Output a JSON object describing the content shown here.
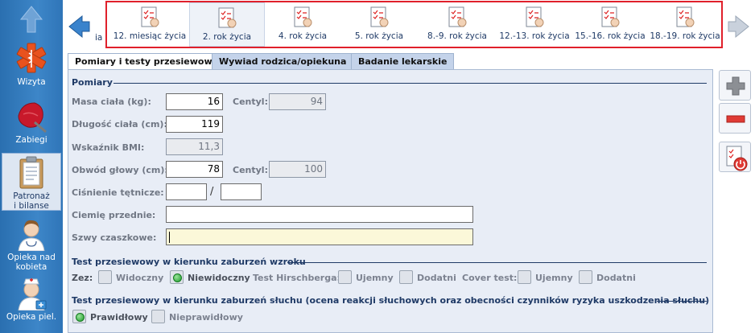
{
  "sidebar": {
    "items": [
      {
        "label": "Wizyta",
        "icon": "star-of-life-icon"
      },
      {
        "label": "Zabiegi",
        "icon": "leaf-icon"
      },
      {
        "label": "Patronaż\ni bilanse",
        "icon": "clipboard-icon"
      },
      {
        "label": "Opieka nad\nkobieta",
        "icon": "doctor-icon"
      },
      {
        "label": "Opieka piel.",
        "icon": "nurse-icon"
      }
    ]
  },
  "period_tabs": {
    "partial_label": "ia",
    "items": [
      {
        "label": "12. miesiąc życia",
        "selected": false
      },
      {
        "label": "2. rok życia",
        "selected": true
      },
      {
        "label": "4. rok życia",
        "selected": false
      },
      {
        "label": "5. rok życia",
        "selected": false
      },
      {
        "label": "8.-9. rok życia",
        "selected": false
      },
      {
        "label": "12.-13. rok życia",
        "selected": false
      },
      {
        "label": "15.-16. rok życia",
        "selected": false
      },
      {
        "label": "18.-19. rok życia",
        "selected": false
      }
    ]
  },
  "form_tabs": [
    {
      "label": "Pomiary i testy przesiewowe",
      "selected": true
    },
    {
      "label": "Wywiad rodzica/opiekuna",
      "selected": false
    },
    {
      "label": "Badanie lekarskie",
      "selected": false
    }
  ],
  "pomiary": {
    "title": "Pomiary",
    "masa_label": "Masa ciała (kg):",
    "masa_value": "16",
    "masa_centyl_label": "Centyl:",
    "masa_centyl_value": "94",
    "dlugosc_label": "Długość ciała (cm):",
    "dlugosc_value": "119",
    "bmi_label": "Wskaźnik BMI:",
    "bmi_value": "11,3",
    "obwod_label": "Obwód głowy (cm):",
    "obwod_value": "78",
    "obwod_centyl_label": "Centyl:",
    "obwod_centyl_value": "100",
    "cisnienie_label": "Ciśnienie tętnicze:",
    "cisnienie_sys": "",
    "cisnienie_dia": "",
    "slash": "/",
    "ciemie_label": "Ciemię przednie:",
    "ciemie_value": "",
    "szwy_label": "Szwy czaszkowe:",
    "szwy_value": ""
  },
  "wzrok": {
    "title": "Test przesiewowy w kierunku zaburzeń wzroku",
    "zez_label": "Zez:",
    "widoczny": "Widoczny",
    "niewidoczny": "Niewidoczny",
    "hirschberg_label": "Test Hirschberga:",
    "hirschberg_ujemny": "Ujemny",
    "hirschberg_dodatni": "Dodatni",
    "cover_label": "Cover test:",
    "cover_ujemny": "Ujemny",
    "cover_dodatni": "Dodatni",
    "selected": "Niewidoczny"
  },
  "sluch": {
    "title": "Test przesiewowy w kierunku zaburzeń słuchu (ocena reakcji słuchowych oraz obecności czynników ryzyka uszkodzenia słuchu)",
    "prawidlowy": "Prawidłowy",
    "nieprawidlowy": "Nieprawidłowy",
    "selected": "Prawidłowy"
  },
  "colors": {
    "sidebar": "#2f75b8",
    "highlight_frame": "#e0202b",
    "panel_bg": "#e8edf6",
    "section_title": "#1f3a66",
    "check_on": "#1c9a2a"
  }
}
